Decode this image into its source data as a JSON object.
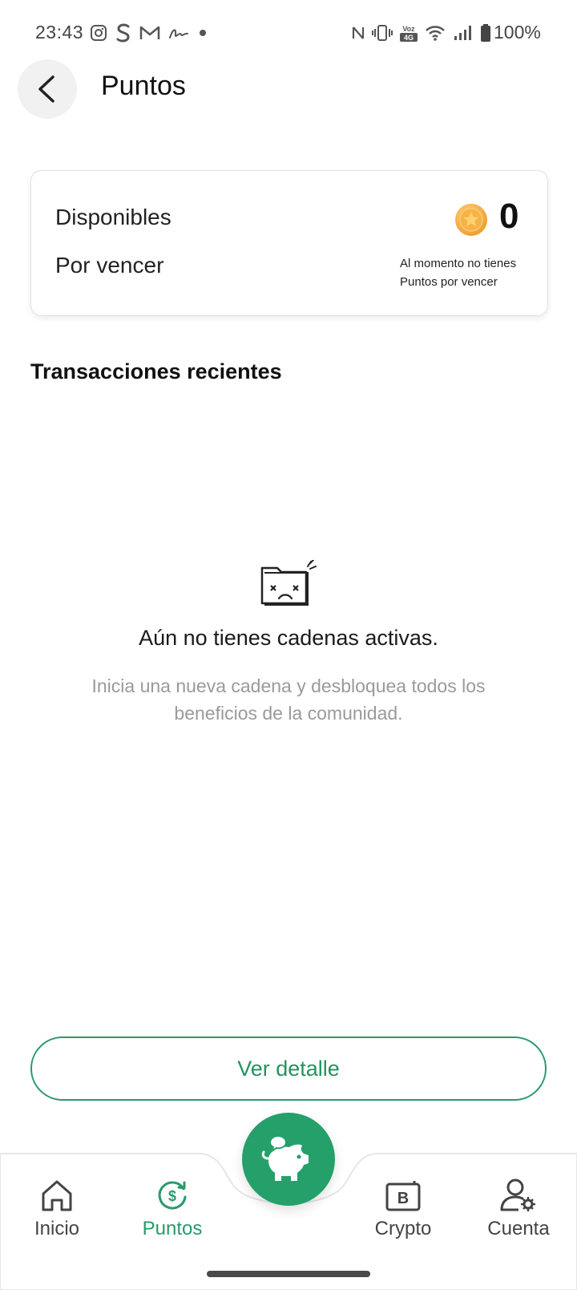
{
  "status_bar": {
    "time": "23:43",
    "battery": "100%",
    "icons_left": [
      "instagram-icon",
      "s-icon",
      "gmail-icon",
      "signature-icon",
      "dot-icon"
    ],
    "icons_right": [
      "nfc-icon",
      "vibrate-icon",
      "volte-icon",
      "wifi-icon",
      "signal-icon",
      "battery-icon"
    ],
    "volte_text": "Voz 4G"
  },
  "header": {
    "title": "Puntos"
  },
  "points_card": {
    "available_label": "Disponibles",
    "expiring_label": "Por vencer",
    "available_value": "0",
    "expiring_message_line1": "Al momento no tienes",
    "expiring_message_line2": "Puntos por vencer"
  },
  "transactions": {
    "title": "Transacciones recientes",
    "empty_title": "Aún no tienes cadenas activas.",
    "empty_description_line1": "Inicia una nueva cadena y desbloquea todos los",
    "empty_description_line2": "beneficios de la comunidad."
  },
  "detail_button": {
    "label": "Ver detalle"
  },
  "bottom_nav": {
    "items": [
      {
        "label": "Inicio",
        "icon": "home-icon",
        "active": false
      },
      {
        "label": "Puntos",
        "icon": "points-cycle-icon",
        "active": true
      },
      {
        "label": "Crypto",
        "icon": "crypto-wallet-icon",
        "active": false
      },
      {
        "label": "Cuenta",
        "icon": "account-settings-icon",
        "active": false
      }
    ],
    "fab_icon": "piggy-bank-chat-icon"
  },
  "colors": {
    "accent": "#2a9a6b",
    "fab": "#25a06a",
    "muted_text": "#9a9a9a",
    "coin": "#f5a623"
  }
}
